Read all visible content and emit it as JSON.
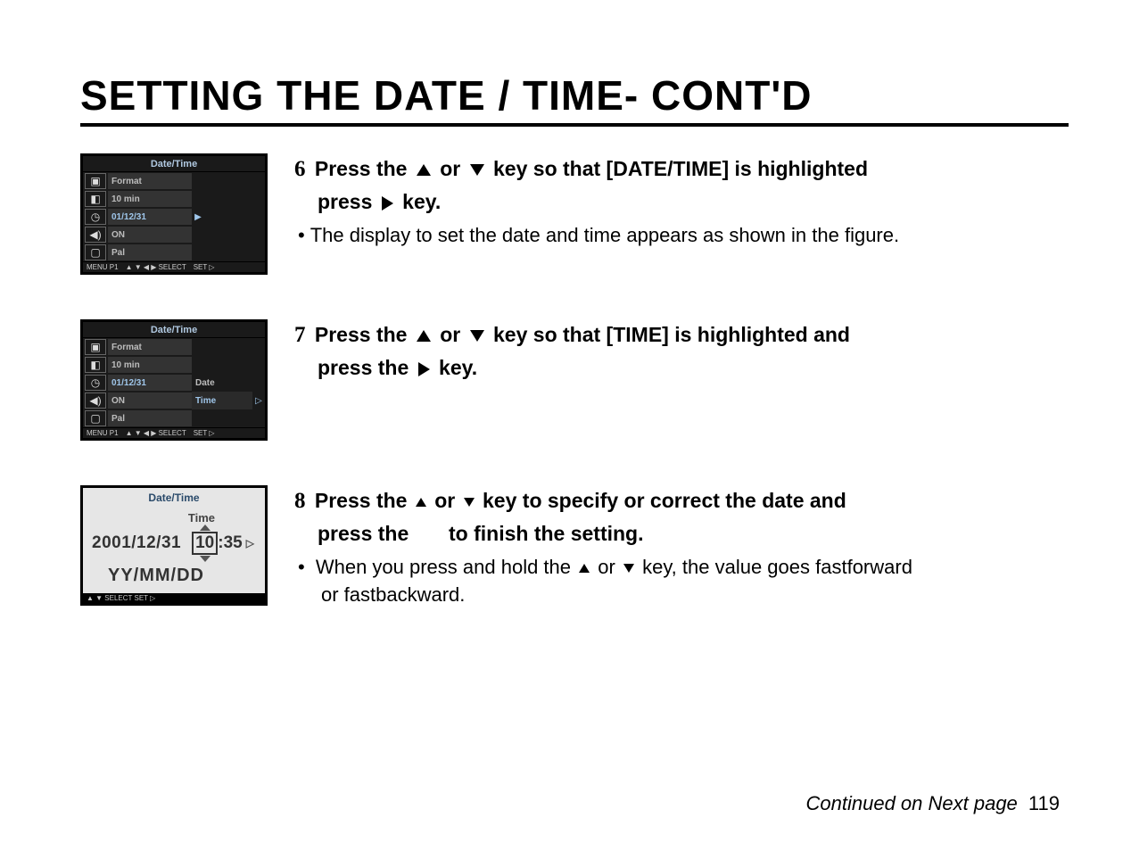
{
  "title": "SETTING THE DATE / TIME- CONT'D",
  "lcd": {
    "title": "Date/Time",
    "rows": {
      "r1": "Format",
      "r2": "10 min",
      "r3": "01/12/31",
      "r4": "ON",
      "r5": "Pal"
    },
    "sub": {
      "date": "Date",
      "time": "Time"
    },
    "footer_menu": "MENU P1",
    "footer_select": "▲ ▼ ◀ ▶ SELECT",
    "footer_set": "SET ▷"
  },
  "lcd2": {
    "title": "Date/Time",
    "time_label": "Time",
    "date": "2001/12/31",
    "hour": "10",
    "minute": "35",
    "fmt": "YY/MM/DD",
    "footer": "▲ ▼  SELECT   SET ▷"
  },
  "steps": {
    "s6": {
      "num": "6",
      "line1a": "Press the",
      "line1b": "or",
      "line1c": "key so that [DATE/TIME] is highlighted",
      "line2a": "press",
      "line2b": "key.",
      "bullet": "The display to set the date and time appears as shown in the figure."
    },
    "s7": {
      "num": "7",
      "line1a": "Press the",
      "line1b": "or",
      "line1c": "key so that [TIME] is highlighted and",
      "line2a": "press the",
      "line2b": "key."
    },
    "s8": {
      "num": "8",
      "line1a": "Press the",
      "line1b": "or",
      "line1c": "key to specify or correct the date and",
      "line2a": "press the",
      "line2b": "to finish the setting.",
      "bullet_a": "When you press and hold the",
      "bullet_b": "or",
      "bullet_c": "key, the value goes fastforward",
      "bullet_d": "or fastbackward."
    }
  },
  "footer": {
    "cont": "Continued on Next page",
    "page": "119"
  }
}
